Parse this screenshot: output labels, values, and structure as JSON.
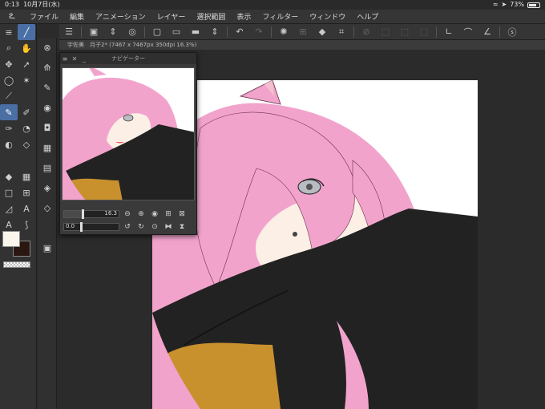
{
  "status": {
    "time": "0:13",
    "date": "10月7日(水)",
    "battery": "73%",
    "battery_level": 0.73
  },
  "menu": [
    "ファイル",
    "編集",
    "アニメーション",
    "レイヤー",
    "選択範囲",
    "表示",
    "フィルター",
    "ウィンドウ",
    "ヘルプ"
  ],
  "document": {
    "tab": "宇佐美　月子2* (7467 x 7467px 350dpi 16.3%)"
  },
  "navigator": {
    "title": "ナビゲーター",
    "zoom": "16.3",
    "rotation": "0.0",
    "zoom_level": 0.33,
    "rotation_level": 0.5
  },
  "colors": {
    "main": "#faf6ec",
    "sub": "#2a1712",
    "hair": "#f2a3cc",
    "cloth": "#222222",
    "skin": "#fcefe6",
    "gold": "#c8912e"
  }
}
